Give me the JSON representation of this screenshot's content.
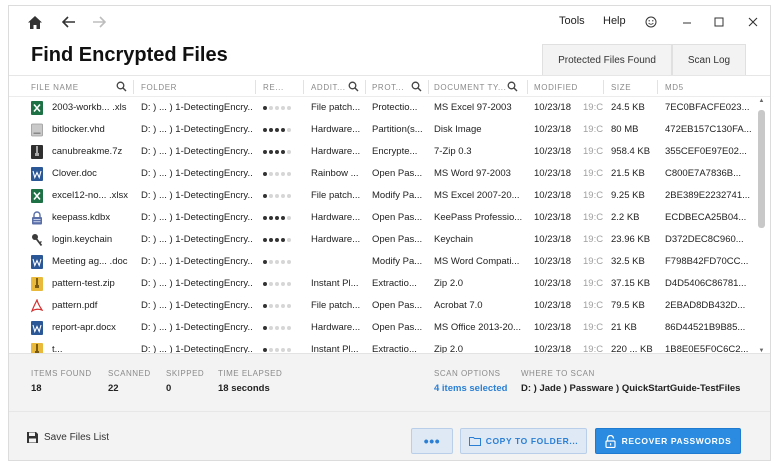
{
  "menu": {
    "tools": "Tools",
    "help": "Help"
  },
  "page_title": "Find Encrypted Files",
  "tabs": [
    {
      "label": "Protected Files Found",
      "active": true
    },
    {
      "label": "Scan Log",
      "active": false
    }
  ],
  "columns": [
    "FILE NAME",
    "FOLDER",
    "RE...",
    "ADDIT...",
    "PROT...",
    "DOCUMENT TY...",
    "MODIFIED",
    "SIZE",
    "MD5"
  ],
  "rows": [
    {
      "name": "2003-workb... .xls",
      "icon": "excel-icon",
      "folder": "D: ) ... ) 1-DetectingEncry...",
      "level": 1,
      "additional": "File patch...",
      "protection": "Protectio...",
      "doctype": "MS Excel 97-2003",
      "date": "10/23/18",
      "time": "19:C",
      "size": "24.5 KB",
      "md5": "7EC0BFACFE023..."
    },
    {
      "name": "bitlocker.vhd",
      "icon": "disk-icon",
      "folder": "D: ) ... ) 1-DetectingEncry...",
      "level": 4,
      "additional": "Hardware...",
      "protection": "Partition(s...",
      "doctype": "Disk Image",
      "date": "10/23/18",
      "time": "19:C",
      "size": "80 MB",
      "md5": "472EB157C130FA..."
    },
    {
      "name": "canubreakme.7z",
      "icon": "archive-icon",
      "folder": "D: ) ... ) 1-DetectingEncry...",
      "level": 4,
      "additional": "Hardware...",
      "protection": "Encrypte...",
      "doctype": "7-Zip 0.3",
      "date": "10/23/18",
      "time": "19:C",
      "size": "958.4 KB",
      "md5": "355CEF0E97E02..."
    },
    {
      "name": "Clover.doc",
      "icon": "word-icon",
      "folder": "D: ) ... ) 1-DetectingEncry...",
      "level": 1,
      "additional": "Rainbow ...",
      "protection": "Open Pas...",
      "doctype": "MS Word 97-2003",
      "date": "10/23/18",
      "time": "19:C",
      "size": "21.5 KB",
      "md5": "C800E7A7836B..."
    },
    {
      "name": "excel12-no... .xlsx",
      "icon": "excel-icon",
      "folder": "D: ) ... ) 1-DetectingEncry...",
      "level": 1,
      "additional": "File patch...",
      "protection": "Modify Pa...",
      "doctype": "MS Excel 2007-20...",
      "date": "10/23/18",
      "time": "19:C",
      "size": "9.25 KB",
      "md5": "2BE389E2232741..."
    },
    {
      "name": "keepass.kdbx",
      "icon": "lock-file-icon",
      "folder": "D: ) ... ) 1-DetectingEncry...",
      "level": 4,
      "additional": "Hardware...",
      "protection": "Open Pas...",
      "doctype": "KeePass Professio...",
      "date": "10/23/18",
      "time": "19:C",
      "size": "2.2 KB",
      "md5": "ECDBECA25B04..."
    },
    {
      "name": "login.keychain",
      "icon": "key-icon",
      "folder": "D: ) ... ) 1-DetectingEncry...",
      "level": 4,
      "additional": "Hardware...",
      "protection": "Open Pas...",
      "doctype": "Keychain",
      "date": "10/23/18",
      "time": "19:C",
      "size": "23.96 KB",
      "md5": "D372DEC8C960..."
    },
    {
      "name": "Meeting ag... .doc",
      "icon": "word-icon",
      "folder": "D: ) ... ) 1-DetectingEncry...",
      "level": 1,
      "additional": "",
      "protection": "Modify Pa...",
      "doctype": "MS Word Compati...",
      "date": "10/23/18",
      "time": "19:C",
      "size": "32.5 KB",
      "md5": "F798B42FD70CC..."
    },
    {
      "name": "pattern-test.zip",
      "icon": "zip-icon",
      "folder": "D: ) ... ) 1-DetectingEncry...",
      "level": 1,
      "additional": "Instant Pl...",
      "protection": "Extractio...",
      "doctype": "Zip 2.0",
      "date": "10/23/18",
      "time": "19:C",
      "size": "37.15 KB",
      "md5": "D4D5406C86781..."
    },
    {
      "name": "pattern.pdf",
      "icon": "pdf-icon",
      "folder": "D: ) ... ) 1-DetectingEncry...",
      "level": 1,
      "additional": "File patch...",
      "protection": "Open Pas...",
      "doctype": "Acrobat 7.0",
      "date": "10/23/18",
      "time": "19:C",
      "size": "79.5 KB",
      "md5": "2EBAD8DB432D..."
    },
    {
      "name": "report-apr.docx",
      "icon": "word-icon",
      "folder": "D: ) ... ) 1-DetectingEncry...",
      "level": 1,
      "additional": "Hardware...",
      "protection": "Open Pas...",
      "doctype": "MS Office 2013-20...",
      "date": "10/23/18",
      "time": "19:C",
      "size": "21 KB",
      "md5": "86D44521B9B85..."
    },
    {
      "name": "t...",
      "icon": "zip-icon",
      "folder": "D: ) ... ) 1-DetectingEncry...",
      "level": 1,
      "additional": "Instant Pl...",
      "protection": "Extractio...",
      "doctype": "Zip 2.0",
      "date": "10/23/18",
      "time": "19:C",
      "size": "220 ... KB",
      "md5": "1B8E0E5F0C6C2..."
    }
  ],
  "status": {
    "items_found_label": "ITEMS FOUND",
    "items_found": "18",
    "scanned_label": "SCANNED",
    "scanned": "22",
    "skipped_label": "SKIPPED",
    "skipped": "0",
    "elapsed_label": "TIME ELAPSED",
    "elapsed": "18 seconds",
    "scan_options_label": "SCAN OPTIONS",
    "scan_options": "4 items selected",
    "where_label": "WHERE TO SCAN",
    "where": "D: ) Jade ) Passware ) QuickStartGuide-TestFiles"
  },
  "bottom": {
    "save_list": "Save Files List",
    "more": "•••",
    "copy": "COPY TO FOLDER...",
    "recover": "RECOVER PASSWORDS"
  },
  "colors": {
    "accent": "#2a8be0",
    "link": "#2a7fd4"
  }
}
